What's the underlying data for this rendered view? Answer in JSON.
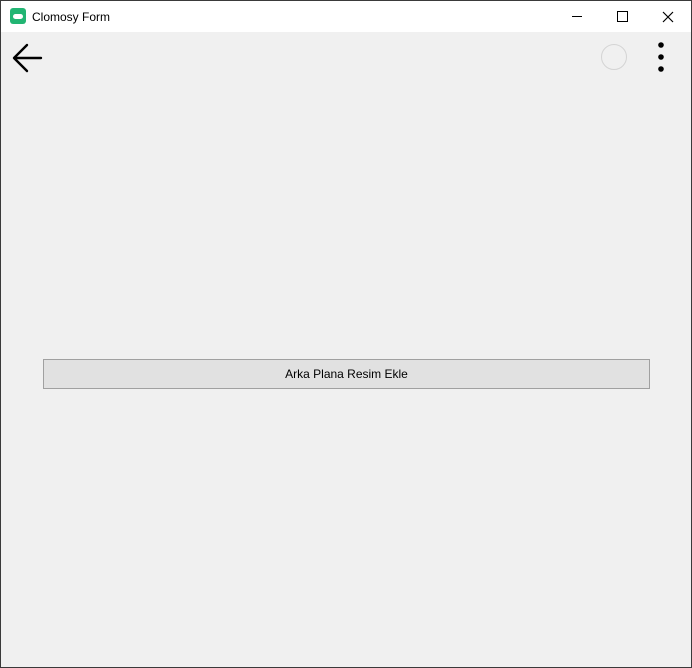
{
  "window": {
    "title": "Clomosy Form",
    "icon": "clomosy-app-icon",
    "controls": [
      "minimize-icon",
      "maximize-icon",
      "close-icon"
    ]
  },
  "toolbar": {
    "back_icon": "arrow-left-icon",
    "indicator": "circle-loading-icon",
    "menu_icon": "more-vertical-icon"
  },
  "main": {
    "add_background_label": "Arka Plana Resim Ekle"
  },
  "colors": {
    "app_icon": "#22b573",
    "background": "#f0f0f0",
    "titlebar": "#ffffff",
    "button_face": "#e1e1e1",
    "button_border": "#a0a0a0"
  }
}
